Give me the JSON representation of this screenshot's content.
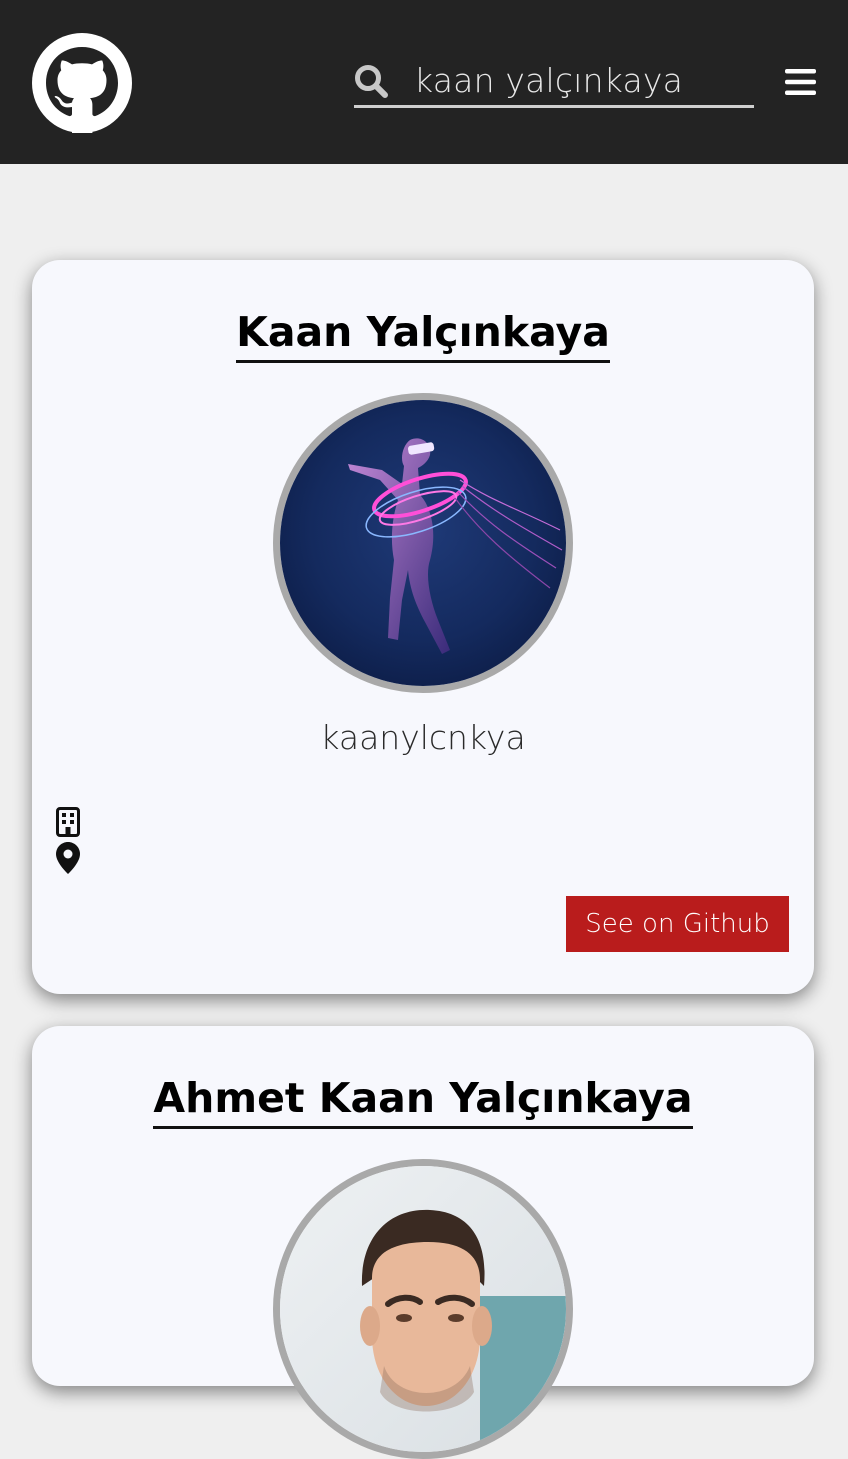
{
  "header": {
    "logo_icon": "github-octocat-icon",
    "search_icon": "search-icon",
    "search_value": "kaan yalçınkaya",
    "menu_icon": "hamburger-menu-icon"
  },
  "results": [
    {
      "name": "Kaan Yalçınkaya",
      "username": "kaanylcnkya",
      "company_icon": "building-icon",
      "location_icon": "map-pin-icon",
      "button_label": "See on Github"
    },
    {
      "name": "Ahmet Kaan Yalçınkaya"
    }
  ],
  "colors": {
    "header_bg": "#232323",
    "page_bg": "#efefef",
    "card_bg": "#f7f8fd",
    "button_bg": "#b91c1c",
    "avatar_border": "#a9a9a9"
  }
}
